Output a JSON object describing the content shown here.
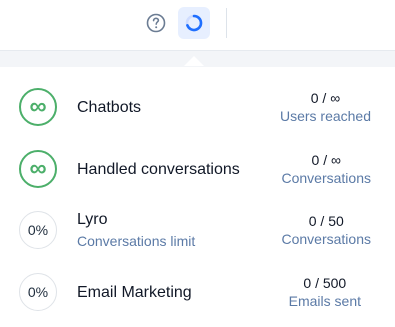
{
  "topbar": {
    "help_icon": "question-circle-icon",
    "usage_icon": "usage-ring-icon"
  },
  "usage": {
    "items": [
      {
        "badge": "∞",
        "badge_type": "unlimited",
        "title": "Chatbots",
        "subtitle": "",
        "value": "0 / ∞",
        "value_label": "Users reached"
      },
      {
        "badge": "∞",
        "badge_type": "unlimited",
        "title": "Handled conversations",
        "subtitle": "",
        "value": "0 / ∞",
        "value_label": "Conversations"
      },
      {
        "badge": "0%",
        "badge_type": "percent",
        "title": "Lyro",
        "subtitle": "Conversations limit",
        "value": "0 / 50",
        "value_label": "Conversations"
      },
      {
        "badge": "0%",
        "badge_type": "percent",
        "title": "Email Marketing",
        "subtitle": "",
        "value": "0 / 500",
        "value_label": "Emails sent"
      }
    ]
  },
  "colors": {
    "accent": "#1f6fff",
    "success": "#4caf6a",
    "muted_link": "#5b7aa6"
  }
}
